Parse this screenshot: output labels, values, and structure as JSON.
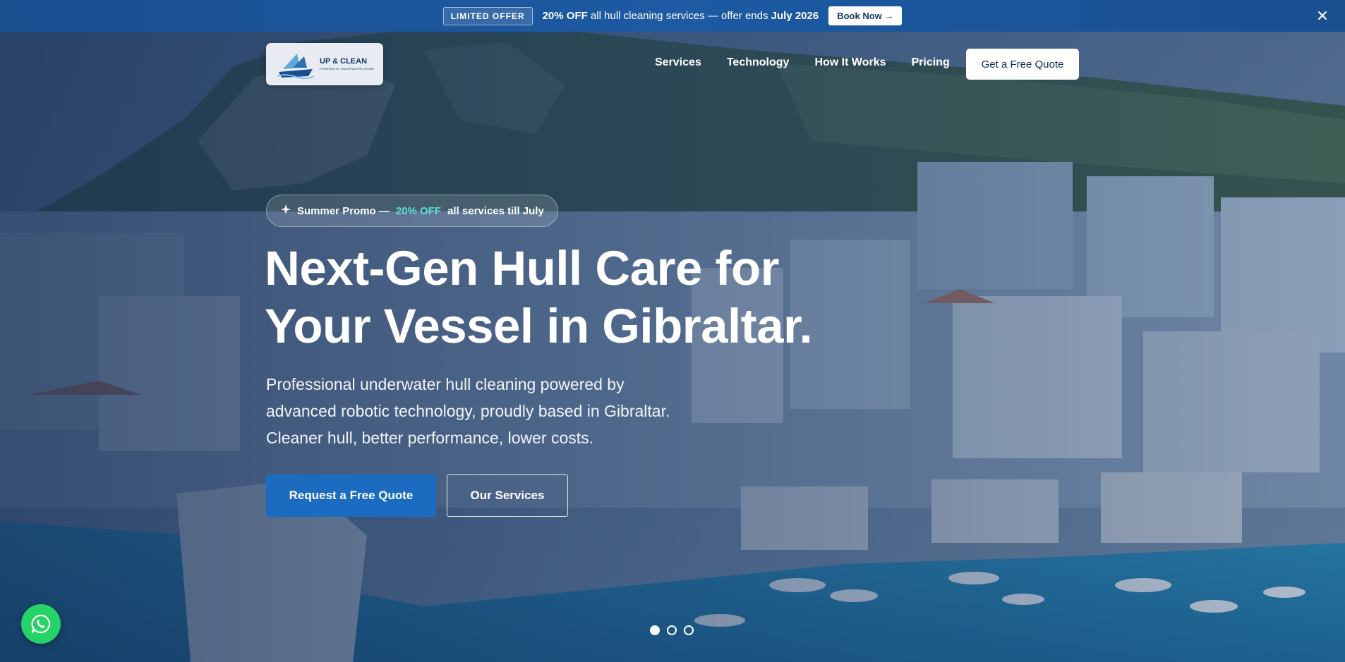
{
  "colors": {
    "promo_bar": "#1d5aa3",
    "primary_button": "#1b6bc0",
    "accent_teal": "#5fe0d6",
    "whatsapp_green": "#25d366"
  },
  "promo_bar": {
    "badge": "LIMITED OFFER",
    "discount": "20% OFF",
    "text": "all hull cleaning services — offer ends",
    "date": "July 2026",
    "button": "Book Now →",
    "close_icon": "close-icon"
  },
  "nav": {
    "logo_main": "UP & CLEAN",
    "logo_sub": "POWERED BY UNDERWATER DRONE",
    "links": [
      "Services",
      "Technology",
      "How It Works",
      "Pricing"
    ],
    "cta": "Get a Free Quote"
  },
  "hero": {
    "pill_icon": "sparkle-icon",
    "pill_prefix": "Summer Promo —",
    "pill_accent": "20% OFF",
    "pill_suffix": "all services till July",
    "title_lines": [
      "Next-Gen Hull Care for",
      "Your Vessel in Gibraltar."
    ],
    "subtitle_lines": [
      "Professional underwater hull cleaning powered by",
      "advanced robotic technology, proudly based in Gibraltar.",
      "Cleaner hull, better performance, lower costs."
    ],
    "primary_button": "Request a Free Quote",
    "secondary_button": "Our Services"
  },
  "carousel": {
    "slide_count": 3,
    "active_index": 0
  },
  "floating": {
    "whatsapp_icon": "whatsapp-icon"
  }
}
